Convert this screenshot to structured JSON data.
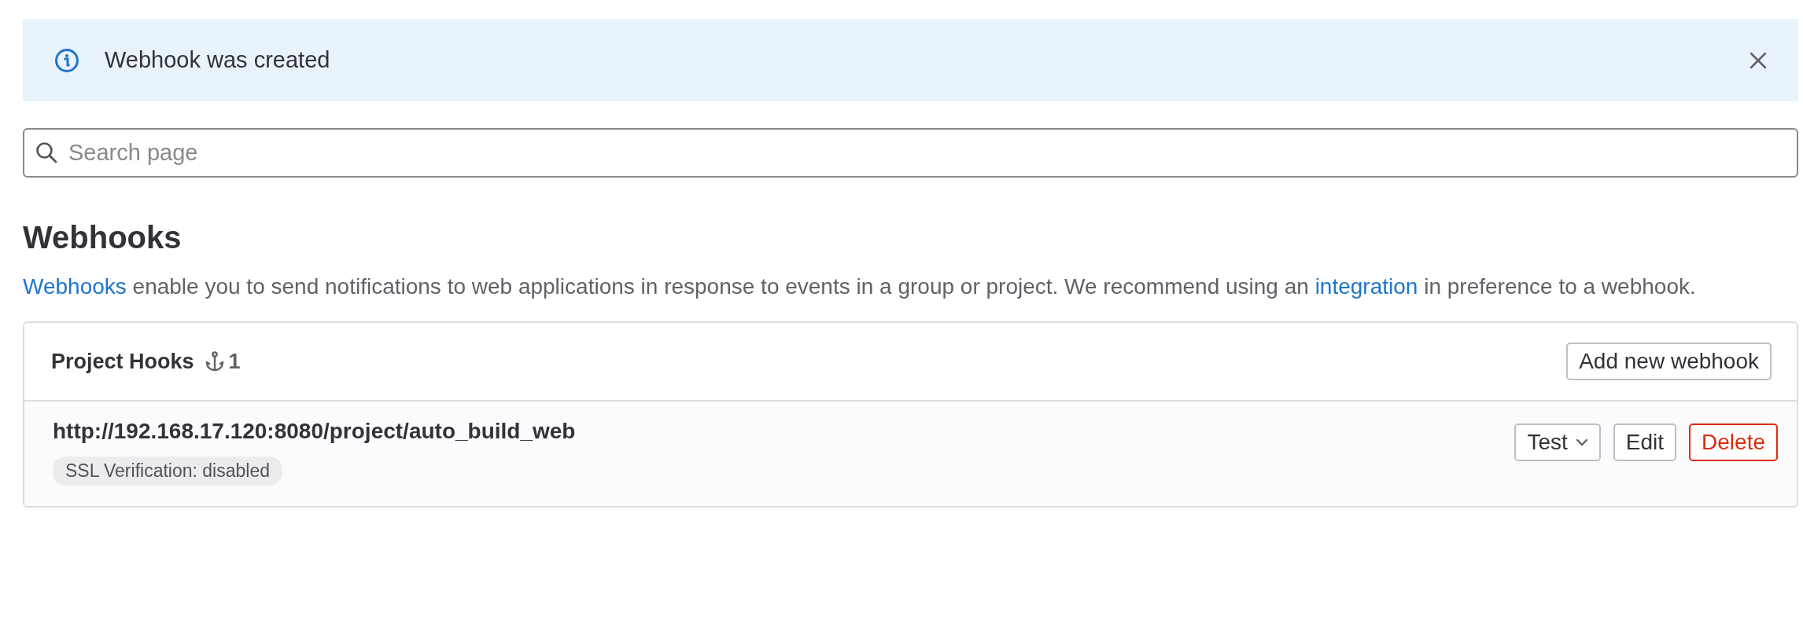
{
  "alert": {
    "message": "Webhook was created",
    "dismissible": true
  },
  "search": {
    "placeholder": "Search page"
  },
  "heading": "Webhooks",
  "description": [
    {
      "text": "Webhooks",
      "link": true
    },
    {
      "text": " enable you to send notifications to web applications in response to events in a group or project. We recommend using an ",
      "link": false
    },
    {
      "text": "integration",
      "link": true
    },
    {
      "text": " in preference to a webhook.",
      "link": false
    }
  ],
  "hooks_card": {
    "title": "Project Hooks",
    "count": "1",
    "add_button": "Add new webhook",
    "hooks": [
      {
        "url": "http://192.168.17.120:8080/project/auto_build_web",
        "badge": "SSL Verification: disabled",
        "actions": [
          {
            "label": "Test",
            "kind": "dropdown"
          },
          {
            "label": "Edit",
            "kind": "default"
          },
          {
            "label": "Delete",
            "kind": "danger"
          }
        ]
      }
    ]
  }
}
